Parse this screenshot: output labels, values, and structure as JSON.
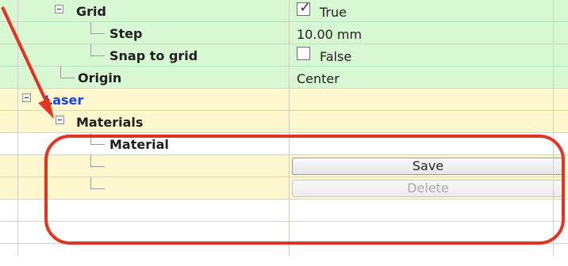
{
  "properties": {
    "grid": {
      "label": "Grid",
      "value": "True",
      "checked": true
    },
    "step": {
      "label": "Step",
      "value": "10.00 mm"
    },
    "snap_to_grid": {
      "label": "Snap to grid",
      "value": "False",
      "checked": false
    },
    "origin": {
      "label": "Origin",
      "value": "Center"
    },
    "laser": {
      "label": "Laser"
    },
    "materials": {
      "label": "Materials"
    },
    "material": {
      "label": "Material",
      "value": ""
    },
    "save_button": {
      "label": "Save"
    },
    "delete_button": {
      "label": "Delete"
    }
  },
  "icons": {
    "expand_icon": "minus-square-icon",
    "checkbox_icon": "checkbox-icon",
    "arrow_icon": "red-arrow-icon"
  },
  "colors": {
    "green_row": "#d8f7d3",
    "yellow_row": "#fff8cf",
    "laser_text": "#1a42e8",
    "highlight": "#e53321"
  }
}
